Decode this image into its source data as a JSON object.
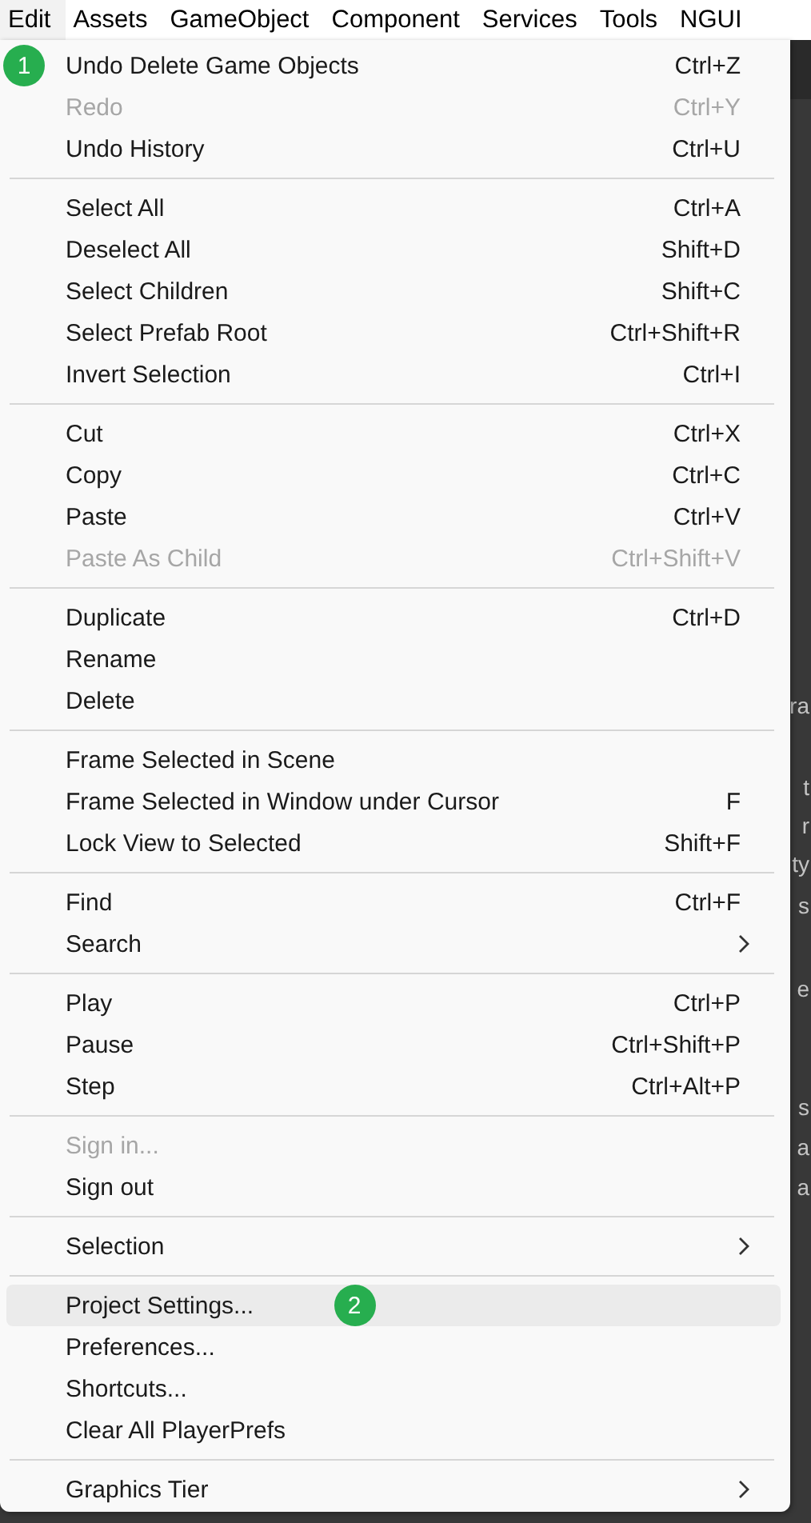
{
  "menubar": [
    {
      "label": "Edit",
      "selected": true
    },
    {
      "label": "Assets",
      "selected": false
    },
    {
      "label": "GameObject",
      "selected": false
    },
    {
      "label": "Component",
      "selected": false
    },
    {
      "label": "Services",
      "selected": false
    },
    {
      "label": "Tools",
      "selected": false
    },
    {
      "label": "NGUI",
      "selected": false
    }
  ],
  "menu": {
    "groups": [
      [
        {
          "label": "Undo Delete Game Objects",
          "shortcut": "Ctrl+Z",
          "disabled": false,
          "highlighted": false,
          "submenu": false,
          "annotation": {
            "text": "1",
            "kind": "left"
          }
        },
        {
          "label": "Redo",
          "shortcut": "Ctrl+Y",
          "disabled": true,
          "highlighted": false,
          "submenu": false
        },
        {
          "label": "Undo History",
          "shortcut": "Ctrl+U",
          "disabled": false,
          "highlighted": false,
          "submenu": false
        }
      ],
      [
        {
          "label": "Select All",
          "shortcut": "Ctrl+A",
          "disabled": false,
          "highlighted": false,
          "submenu": false
        },
        {
          "label": "Deselect All",
          "shortcut": "Shift+D",
          "disabled": false,
          "highlighted": false,
          "submenu": false
        },
        {
          "label": "Select Children",
          "shortcut": "Shift+C",
          "disabled": false,
          "highlighted": false,
          "submenu": false
        },
        {
          "label": "Select Prefab Root",
          "shortcut": "Ctrl+Shift+R",
          "disabled": false,
          "highlighted": false,
          "submenu": false
        },
        {
          "label": "Invert Selection",
          "shortcut": "Ctrl+I",
          "disabled": false,
          "highlighted": false,
          "submenu": false
        }
      ],
      [
        {
          "label": "Cut",
          "shortcut": "Ctrl+X",
          "disabled": false,
          "highlighted": false,
          "submenu": false
        },
        {
          "label": "Copy",
          "shortcut": "Ctrl+C",
          "disabled": false,
          "highlighted": false,
          "submenu": false
        },
        {
          "label": "Paste",
          "shortcut": "Ctrl+V",
          "disabled": false,
          "highlighted": false,
          "submenu": false
        },
        {
          "label": "Paste As Child",
          "shortcut": "Ctrl+Shift+V",
          "disabled": true,
          "highlighted": false,
          "submenu": false
        }
      ],
      [
        {
          "label": "Duplicate",
          "shortcut": "Ctrl+D",
          "disabled": false,
          "highlighted": false,
          "submenu": false
        },
        {
          "label": "Rename",
          "disabled": false,
          "highlighted": false,
          "submenu": false
        },
        {
          "label": "Delete",
          "disabled": false,
          "highlighted": false,
          "submenu": false
        }
      ],
      [
        {
          "label": "Frame Selected in Scene",
          "disabled": false,
          "highlighted": false,
          "submenu": false
        },
        {
          "label": "Frame Selected in Window under Cursor",
          "shortcut": "F",
          "disabled": false,
          "highlighted": false,
          "submenu": false
        },
        {
          "label": "Lock View to Selected",
          "shortcut": "Shift+F",
          "disabled": false,
          "highlighted": false,
          "submenu": false
        }
      ],
      [
        {
          "label": "Find",
          "shortcut": "Ctrl+F",
          "disabled": false,
          "highlighted": false,
          "submenu": false
        },
        {
          "label": "Search",
          "disabled": false,
          "highlighted": false,
          "submenu": true
        }
      ],
      [
        {
          "label": "Play",
          "shortcut": "Ctrl+P",
          "disabled": false,
          "highlighted": false,
          "submenu": false
        },
        {
          "label": "Pause",
          "shortcut": "Ctrl+Shift+P",
          "disabled": false,
          "highlighted": false,
          "submenu": false
        },
        {
          "label": "Step",
          "shortcut": "Ctrl+Alt+P",
          "disabled": false,
          "highlighted": false,
          "submenu": false
        }
      ],
      [
        {
          "label": "Sign in...",
          "disabled": true,
          "highlighted": false,
          "submenu": false
        },
        {
          "label": "Sign out",
          "disabled": false,
          "highlighted": false,
          "submenu": false
        }
      ],
      [
        {
          "label": "Selection",
          "disabled": false,
          "highlighted": false,
          "submenu": true
        }
      ],
      [
        {
          "label": "Project Settings...",
          "disabled": false,
          "highlighted": true,
          "submenu": false,
          "annotation": {
            "text": "2",
            "kind": "after"
          }
        },
        {
          "label": "Preferences...",
          "disabled": false,
          "highlighted": false,
          "submenu": false
        },
        {
          "label": "Shortcuts...",
          "disabled": false,
          "highlighted": false,
          "submenu": false
        },
        {
          "label": "Clear All PlayerPrefs",
          "disabled": false,
          "highlighted": false,
          "submenu": false
        }
      ],
      [
        {
          "label": "Graphics Tier",
          "disabled": false,
          "highlighted": false,
          "submenu": true
        }
      ]
    ]
  },
  "background_panel": {
    "texts": [
      "ra",
      "t",
      "r",
      "ty",
      "s",
      "e",
      "s",
      "a",
      "a"
    ]
  }
}
